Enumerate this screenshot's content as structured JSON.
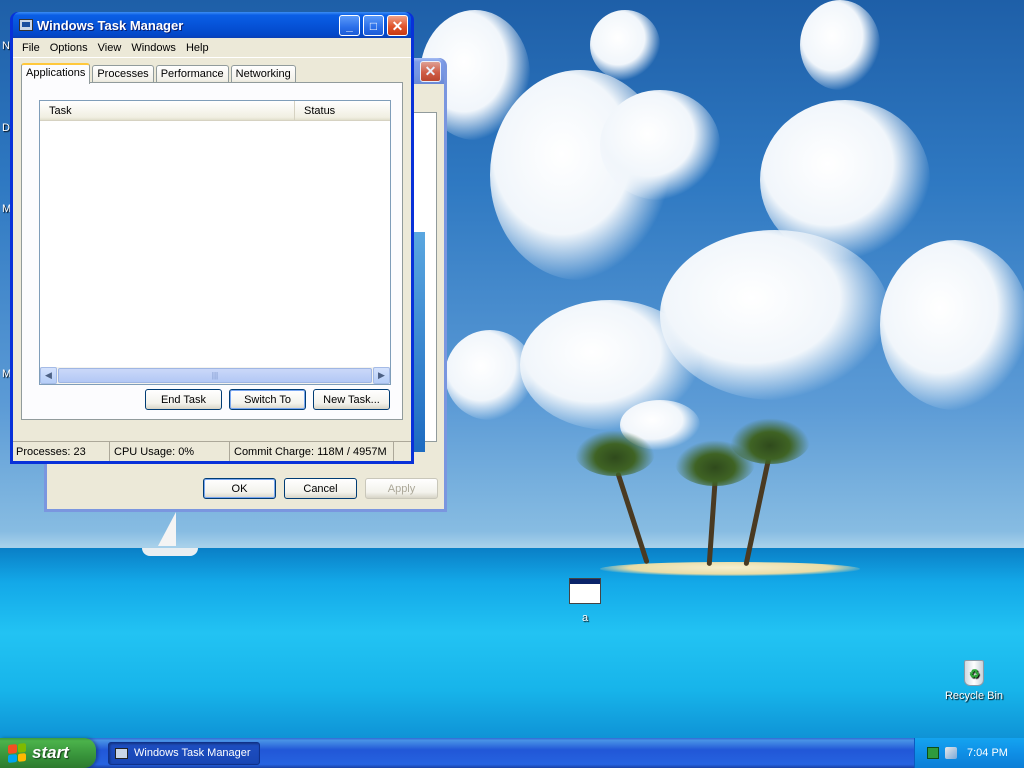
{
  "desktop": {
    "icons": {
      "recycle_bin": "Recycle Bin",
      "app_label": "a"
    },
    "edge_letters": [
      "N",
      "D",
      "M",
      "M"
    ]
  },
  "back_window": {
    "ok_label": "OK",
    "cancel_label": "Cancel",
    "apply_label": "Apply"
  },
  "task_manager": {
    "title": "Windows Task Manager",
    "menu": [
      "File",
      "Options",
      "View",
      "Windows",
      "Help"
    ],
    "tabs": [
      "Applications",
      "Processes",
      "Performance",
      "Networking"
    ],
    "active_tab": "Applications",
    "columns": [
      "Task",
      "Status"
    ],
    "tasks": [],
    "buttons": {
      "end_task": "End Task",
      "switch_to": "Switch To",
      "new_task": "New Task..."
    },
    "status": {
      "processes": "Processes: 23",
      "cpu": "CPU Usage: 0%",
      "commit": "Commit Charge: 118M / 4957M"
    }
  },
  "taskbar": {
    "start_label": "start",
    "task_button": "Windows Task Manager",
    "clock": "7:04 PM"
  },
  "colors": {
    "title_bar": "#0653d8",
    "window_face": "#ece9d8",
    "taskbar": "#2157d7",
    "start_green": "#37933a",
    "tray": "#0f8fe6"
  }
}
